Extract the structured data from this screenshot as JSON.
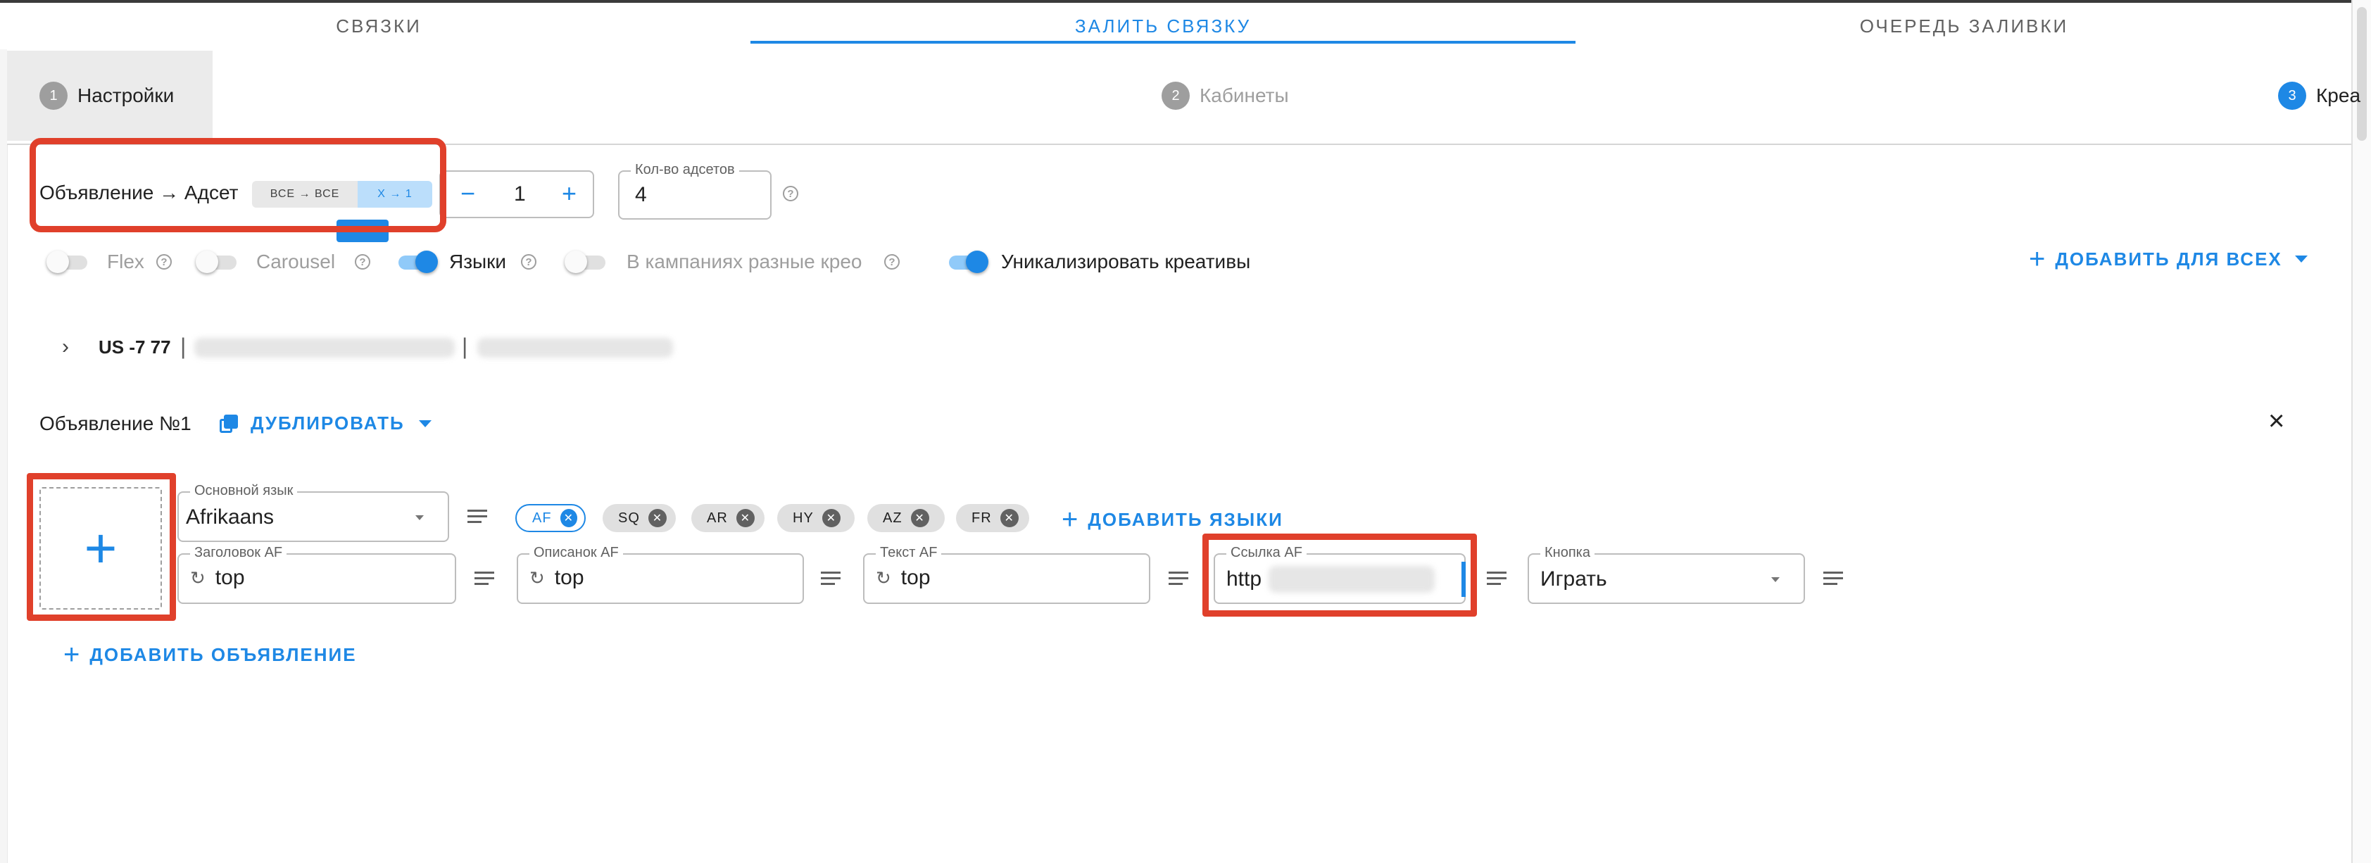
{
  "tabs": [
    "СВЯЗКИ",
    "ЗАЛИТЬ СВЯЗКУ",
    "ОЧЕРЕДЬ ЗАЛИВКИ"
  ],
  "steps": [
    {
      "num": "1",
      "label": "Настройки"
    },
    {
      "num": "2",
      "label": "Кабинеты"
    },
    {
      "num": "3",
      "label": "Креа"
    }
  ],
  "mapping": {
    "label": "Объявление → Адсет",
    "opt_all": "ВСЕ → ВСЕ",
    "opt_x": "Х → 1",
    "counter_value": "1",
    "minus": "−",
    "plus": "+"
  },
  "adsets": {
    "label": "Кол-во адсетов",
    "value": "4"
  },
  "toggles": [
    {
      "label": "Flex",
      "on": false
    },
    {
      "label": "Carousel",
      "on": false
    },
    {
      "label": "Языки",
      "on": true
    },
    {
      "label": "В кампаниях разные крео",
      "on": false
    },
    {
      "label": "Уникализировать креативы",
      "on": true
    }
  ],
  "add_for_all": "ДОБАВИТЬ ДЛЯ ВСЕХ",
  "campaign": {
    "title": "US -7 77",
    "sep": "|"
  },
  "ad": {
    "title": "Объявление №1",
    "duplicate": "ДУБЛИРОВАТЬ",
    "close": "×",
    "add_media": "+",
    "main_language_label": "Основной язык",
    "main_language": "Afrikaans",
    "languages": [
      "AF",
      "SQ",
      "AR",
      "HY",
      "AZ",
      "FR"
    ],
    "add_languages": "ДОБАВИТЬ ЯЗЫКИ",
    "headline_label": "Заголовок AF",
    "headline": "top",
    "description_label": "Описанок AF",
    "description": "top",
    "text_label": "Текст AF",
    "text": "top",
    "link_label": "Ссылка AF",
    "link": "http",
    "button_label": "Кнопка",
    "button_value": "Играть"
  },
  "add_ad": "ДОБАВИТЬ ОБЪЯВЛЕНИЕ",
  "colors": {
    "accent": "#1e88e5",
    "highlight": "#e0402b"
  }
}
